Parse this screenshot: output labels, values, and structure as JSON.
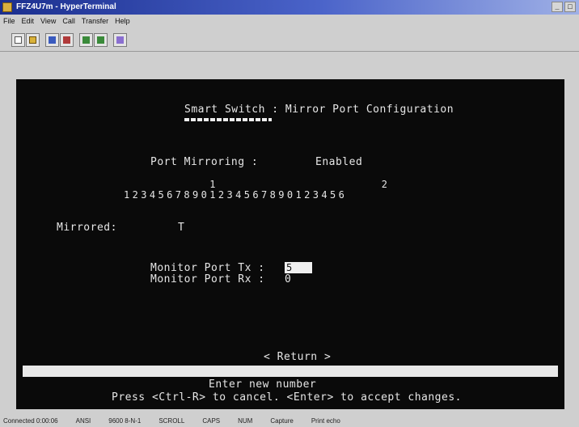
{
  "window": {
    "title": "FFZ4U7m - HyperTerminal",
    "buttons": [
      "_",
      "□"
    ]
  },
  "menu": [
    "File",
    "Edit",
    "View",
    "Call",
    "Transfer",
    "Help"
  ],
  "toolbar": {
    "icons": [
      "new-icon",
      "open-icon",
      "connect-icon",
      "disconnect-icon",
      "send-icon",
      "receive-icon",
      "properties-icon"
    ]
  },
  "terminal": {
    "screen_title": "Smart Switch : Mirror Port Configuration",
    "port_mirroring_label": "Port Mirroring :",
    "port_mirroring_value": "Enabled",
    "port_tens_row": "          1                   2",
    "port_units_row": "12345678901234567890123456",
    "mirrored_label": "Mirrored:",
    "mirrored_marker": "T",
    "monitor_tx_label": "Monitor Port Tx :",
    "monitor_tx_value": "5",
    "monitor_rx_label": "Monitor Port Rx :",
    "monitor_rx_value": "0",
    "return_label": "< Return >",
    "help_line1": "Enter new number",
    "help_line2": "Press <Ctrl-R> to cancel. <Enter> to accept changes."
  },
  "statusbar": {
    "items": [
      "Connected 0:00:06",
      "ANSI",
      "9600 8-N-1",
      "SCROLL",
      "CAPS",
      "NUM",
      "Capture",
      "Print echo"
    ]
  },
  "colors": {
    "titlebar_start": "#1b2f8f",
    "terminal_bg": "#0a0a0a",
    "terminal_fg": "#e6e6e6"
  }
}
